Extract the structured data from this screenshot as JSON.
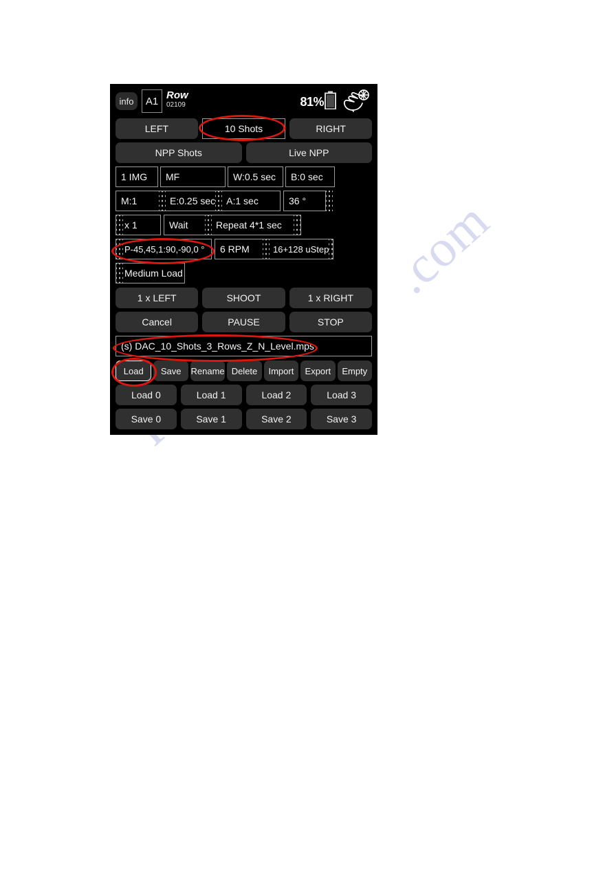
{
  "watermark": {
    "line1": "manualslib",
    "line2": ".com"
  },
  "header": {
    "info_label": "info",
    "axis_label": "A1",
    "mode_title": "Row",
    "mode_sub": "02109",
    "battery_percent": "81%",
    "battery_icon": "battery-icon",
    "hand_icon": "hand-tap-icon"
  },
  "mode_row": {
    "left_label": "LEFT",
    "shots_label": "10 Shots",
    "right_label": "RIGHT"
  },
  "npp_row": {
    "npp_shots_label": "NPP Shots",
    "live_npp_label": "Live NPP"
  },
  "params_row1": [
    {
      "name": "image-count",
      "value": "1 IMG"
    },
    {
      "name": "focus-mode",
      "value": "MF"
    },
    {
      "name": "wait-time",
      "value": "W:0.5 sec"
    },
    {
      "name": "bulb-time",
      "value": "B:0 sec"
    }
  ],
  "params_row2": [
    {
      "name": "multiplier",
      "value": "M:1"
    },
    {
      "name": "exposure-time",
      "value": "E:0.25 sec"
    },
    {
      "name": "after-time",
      "value": "A:1 sec"
    },
    {
      "name": "angle",
      "value": "36 °"
    }
  ],
  "params_row3": [
    {
      "name": "repeat-count",
      "value": "x 1"
    },
    {
      "name": "wait-mode",
      "value": "Wait"
    },
    {
      "name": "repeat-setting",
      "value": "Repeat 4*1 sec"
    }
  ],
  "params_row4": [
    {
      "name": "pan-program",
      "value": "P-45,45,1:90,-90,0 °"
    },
    {
      "name": "speed-rpm",
      "value": "6 RPM"
    },
    {
      "name": "microstep",
      "value": "16+128 uStep"
    }
  ],
  "load_row": {
    "load_label": "Medium Load"
  },
  "action_row1": {
    "left_step_label": "1 x LEFT",
    "shoot_label": "SHOOT",
    "right_step_label": "1 x RIGHT"
  },
  "action_row2": {
    "cancel_label": "Cancel",
    "pause_label": "PAUSE",
    "stop_label": "STOP"
  },
  "filename": {
    "value": "(s) DAC_10_Shots_3_Rows_Z_N_Level.mps"
  },
  "file_ops": [
    {
      "name": "load",
      "label": "Load",
      "selected": true
    },
    {
      "name": "save",
      "label": "Save",
      "selected": false
    },
    {
      "name": "rename",
      "label": "Rename",
      "selected": false
    },
    {
      "name": "delete",
      "label": "Delete",
      "selected": false
    },
    {
      "name": "import",
      "label": "Import",
      "selected": false
    },
    {
      "name": "export",
      "label": "Export",
      "selected": false
    },
    {
      "name": "empty",
      "label": "Empty",
      "selected": false
    }
  ],
  "load_slots": [
    "Load 0",
    "Load 1",
    "Load 2",
    "Load 3"
  ],
  "save_slots": [
    "Save 0",
    "Save 1",
    "Save 2",
    "Save 3"
  ],
  "colors": {
    "panel_background": "#000000",
    "button_fill": "#303030",
    "field_border": "#9b9b9b",
    "text": "#f2f2f2",
    "annotation": "#d9180f"
  }
}
